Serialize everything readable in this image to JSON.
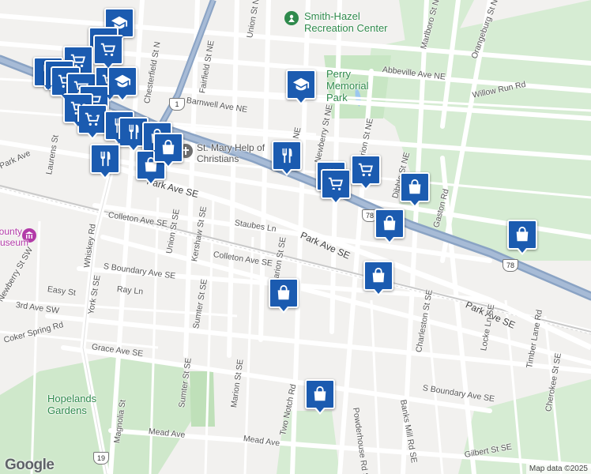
{
  "labels": {
    "smith_hazel": "Smith-Hazel Recreation Center",
    "perry_park": "Perry Memorial Park",
    "st_mary": "St. Mary Help of Christians",
    "hopelands": "Hopelands Gardens",
    "county_museum": "County Museum",
    "streets": {
      "abbeville": "Abbeville Ave NE",
      "willow_run": "Willow Run Rd",
      "barnwell": "Barnwell Ave NE",
      "chesterfield": "Chesterfield St N",
      "fairfield": "Fairfield St NE",
      "union_n": "Union St NE",
      "marlboro": "Marlboro St NE",
      "orangeburg": "Orangeburg St NE",
      "horry": "Horry St NE",
      "marion_ne": "Marion St NE",
      "newberry_ne": "Newberry St NE",
      "dibble": "Dibble St NE",
      "gaston": "Gaston Rd",
      "park_ave_w": "Park Ave",
      "park_se_1": "Park Ave SE",
      "park_se_2": "Park Ave SE",
      "park_se_3": "Park Ave SE",
      "laurens": "Laurens St",
      "colleton_1": "Colleton Ave SE",
      "colleton_2": "Colleton Ave SE",
      "staubes": "Staubes Ln",
      "union_se": "Union St SE",
      "kershaw": "Kershaw St SE",
      "marion_se": "Marion St SE",
      "whiskey": "Whiskey Rd",
      "s_boundary_1": "S Boundary Ave SE",
      "s_boundary_2": "S Boundary Ave SE",
      "ray": "Ray Ln",
      "york": "York St SE",
      "newberry_sw": "Newberry St SW",
      "easy": "Easy St",
      "third_ave": "3rd Ave SW",
      "coker": "Coker Spring Rd",
      "grace": "Grace Ave SE",
      "sumter_1": "Sumter St SE",
      "sumter_2": "Sumter St SE",
      "marion_s2": "Marion St SE",
      "powderhouse": "Powderhouse Rd SE",
      "banks_mill": "Banks Mill Rd SE",
      "charleston": "Charleston St SE",
      "locke": "Locke Ln SE",
      "timber_lane": "Timber Lane Rd",
      "cherokee": "Cherokee St SE",
      "two_notch": "Two Notch Rd",
      "mead": "Mead Ave",
      "mead2": "Mead Ave",
      "magnolia": "Magnolia St",
      "gilbert": "Gilbert St SE",
      "s_boundary_3": "S Boundary Ave SE"
    },
    "shields": {
      "us1": "1",
      "us78_a": "78",
      "us78_b": "78",
      "us19": "19"
    }
  },
  "attribution": {
    "logo": "Google",
    "copyright": "Map data ©2025"
  },
  "markers": [
    {
      "type": "school"
    },
    {
      "type": "shopping-cart"
    },
    {
      "type": "shopping-cart"
    },
    {
      "type": "shopping-cart"
    },
    {
      "type": "restaurant"
    },
    {
      "type": "shopping-bag"
    },
    {
      "type": "school"
    },
    {
      "type": "shopping-cart"
    },
    {
      "type": "restaurant"
    },
    {
      "type": "shopping-bag"
    },
    {
      "type": "shopping-bag"
    },
    {
      "type": "restaurant"
    },
    {
      "type": "restaurant"
    },
    {
      "type": "shopping-bag"
    },
    {
      "type": "school"
    },
    {
      "type": "restaurant"
    },
    {
      "type": "restaurant"
    },
    {
      "type": "shopping-cart"
    },
    {
      "type": "shopping-cart"
    },
    {
      "type": "shopping-bag"
    },
    {
      "type": "shopping-bag"
    },
    {
      "type": "shopping-bag"
    },
    {
      "type": "shopping-bag"
    },
    {
      "type": "shopping-bag"
    },
    {
      "type": "school"
    },
    {
      "type": "shopping-bag"
    }
  ]
}
